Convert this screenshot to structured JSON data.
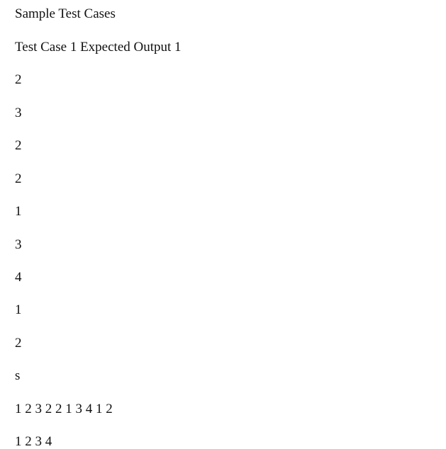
{
  "document": {
    "title": "Sample Test Cases",
    "header_line": "Test Case 1 Expected Output 1",
    "input_lines": [
      "2",
      "3",
      "2",
      "2",
      "1",
      "3",
      "4",
      "1",
      "2"
    ],
    "marker": "s",
    "sequence_line": "1 2 3 2 2 1 3 4 1 2",
    "output_line": "1 2 3 4"
  }
}
